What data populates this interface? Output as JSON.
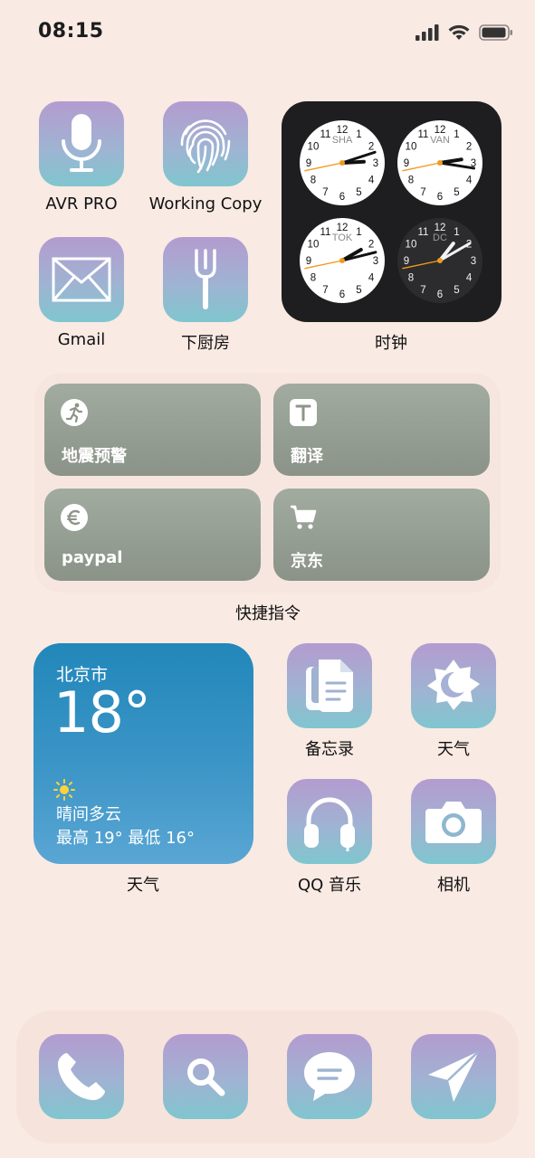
{
  "status_bar": {
    "time": "08:15"
  },
  "apps_top": [
    {
      "label": "AVR PRO",
      "icon": "microphone-icon"
    },
    {
      "label": "Working Copy",
      "icon": "fingerprint-icon"
    },
    {
      "label": "Gmail",
      "icon": "envelope-icon"
    },
    {
      "label": "下厨房",
      "icon": "fork-icon"
    }
  ],
  "clock_widget": {
    "label": "时钟",
    "cities": [
      "SHA",
      "VAN",
      "TOK",
      "DC"
    ],
    "numerals": [
      "12",
      "1",
      "2",
      "3",
      "4",
      "5",
      "6",
      "7",
      "8",
      "9",
      "10",
      "11"
    ]
  },
  "shortcuts": {
    "label": "快捷指令",
    "items": [
      {
        "label": "地震预警",
        "icon": "running-person-icon"
      },
      {
        "label": "翻译",
        "icon": "text-t-icon"
      },
      {
        "label": "paypal",
        "icon": "euro-icon"
      },
      {
        "label": "京东",
        "icon": "cart-icon"
      }
    ]
  },
  "weather_widget": {
    "city": "北京市",
    "temp": "18°",
    "condition": "晴间多云",
    "range": "最高 19° 最低 16°",
    "label": "天气"
  },
  "apps_mid": [
    {
      "label": "备忘录",
      "icon": "documents-icon"
    },
    {
      "label": "天气",
      "icon": "sun-moon-icon"
    },
    {
      "label": "QQ 音乐",
      "icon": "headphones-icon"
    },
    {
      "label": "相机",
      "icon": "camera-icon"
    }
  ],
  "dock": [
    {
      "icon": "phone-icon"
    },
    {
      "icon": "search-icon"
    },
    {
      "icon": "message-icon"
    },
    {
      "icon": "paper-plane-icon"
    }
  ]
}
